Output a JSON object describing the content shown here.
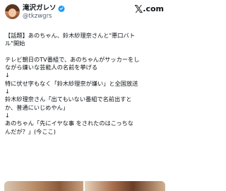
{
  "post": {
    "author_name": "滝沢ガレソ",
    "author_handle": "@tkzwgrs",
    "verified": true,
    "verified_color": "#1d9bf0",
    "brand": {
      "x_mark": "𝕏",
      "domain": ".com"
    },
    "lines": {
      "l1": "【話題】あのちゃん、鈴木紗理奈さんと\"悪口バト",
      "l2": "ル\"開始",
      "l3": "テレビ朝日のTV番組で、あのちゃんがサッカーをし",
      "l4": "ながら嫌いな芸能人の名前を挙げる",
      "l5": "↓",
      "l6": "特に伏せ字もなく「鈴木紗理奈が嫌い」と全国放送",
      "l7": "↓",
      "l8": "鈴木紗理奈さん「出てもいない番組で名前出すと",
      "l9": "か、普通にいじめやん」",
      "l10": "↓",
      "l11": "あのちゃん「先にイヤな事 をされたのはこっちな",
      "l12": "んだが？」(今ここ)"
    }
  }
}
